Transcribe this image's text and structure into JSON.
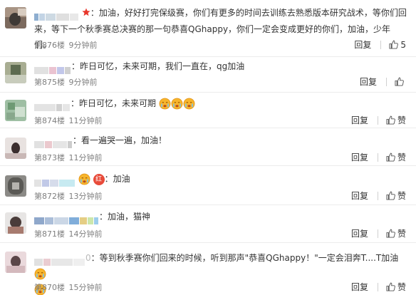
{
  "comments": [
    {
      "text": "加油，好好打完保级赛，你们有更多的时间去训练去熟悉版本研究战术，等你们回来，等下一个秋季赛总决赛的那一句恭喜QGhappy，你们一定会变成更好的你们，加油，少年们。",
      "floor": "第876楼",
      "time": "9分钟前",
      "reply": "回复",
      "like_count": "5"
    },
    {
      "text": "昨日可忆，未来可期，我们一直在，qg加油",
      "floor": "第875楼",
      "time": "9分钟前",
      "reply": "回复"
    },
    {
      "text": "昨日可忆，未来可期",
      "floor": "第874楼",
      "time": "11分钟前",
      "reply": "回复",
      "like_label": "赞"
    },
    {
      "text": "看一遍哭一遍，加油！",
      "floor": "第873楼",
      "time": "11分钟前",
      "reply": "回复",
      "like_label": "赞"
    },
    {
      "badge_text": "红",
      "text": "加油",
      "floor": "第872楼",
      "time": "13分钟前",
      "reply": "回复",
      "like_label": "赞"
    },
    {
      "text": "加油，猫神",
      "floor": "第871楼",
      "time": "14分钟前",
      "reply": "回复",
      "like_label": "赞"
    },
    {
      "name_suffix": "0",
      "text": "等到秋季赛你们回来的时候，听到那声\"恭喜QGhappy！\"一定会泪奔T....T加油",
      "floor": "第870楼",
      "time": "15分钟前",
      "reply": "回复",
      "like_label": "赞"
    }
  ],
  "colors": {
    "text": "#333333",
    "meta": "#808080",
    "separator": "#ececec",
    "vip_star": "#e8372c",
    "emoji": "#f7b52c"
  },
  "icons": [
    "thumbs-up-icon",
    "crying-face-emoji-icon",
    "vip-star-icon"
  ]
}
